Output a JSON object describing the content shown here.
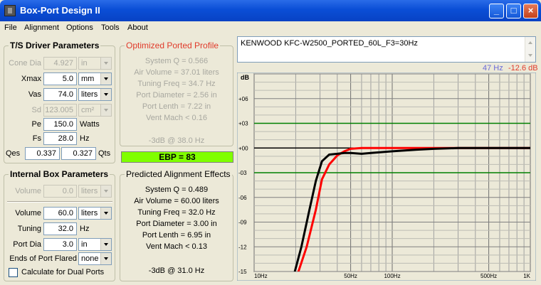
{
  "window": {
    "title": "Box-Port Design II"
  },
  "menu": [
    "File",
    "Alignment",
    "Options",
    "Tools",
    "About"
  ],
  "ts": {
    "title": "T/S Driver Parameters",
    "cone_dia": {
      "label": "Cone Dia",
      "value": "4.927",
      "unit": "in"
    },
    "xmax": {
      "label": "Xmax",
      "value": "5.0",
      "unit": "mm"
    },
    "vas": {
      "label": "Vas",
      "value": "74.0",
      "unit": "liters"
    },
    "sd": {
      "label": "Sd",
      "value": "123.005",
      "unit": "cm²"
    },
    "pe": {
      "label": "Pe",
      "value": "150.0",
      "unit": "Watts"
    },
    "fs": {
      "label": "Fs",
      "value": "28.0",
      "unit": "Hz"
    },
    "qes": {
      "label": "Qes",
      "value": "0.337"
    },
    "qts": {
      "label": "Qts",
      "value": "0.327"
    }
  },
  "box": {
    "title": "Internal Box Parameters",
    "volume_disabled": {
      "label": "Volume",
      "value": "0.0",
      "unit": "liters"
    },
    "volume": {
      "label": "Volume",
      "value": "60.0",
      "unit": "liters"
    },
    "tuning": {
      "label": "Tuning",
      "value": "32.0",
      "unit": "Hz"
    },
    "port_dia": {
      "label": "Port Dia",
      "value": "3.0",
      "unit": "in"
    },
    "flared": {
      "label": "Ends of Port Flared",
      "value": "none"
    },
    "dual": {
      "label": "Calculate for Dual Ports"
    }
  },
  "optimized": {
    "title": "Optimized Ported Profile",
    "lines": [
      "System Q = 0.566",
      "Air Volume = 37.01 liters",
      "Tuning Freq = 34.7 Hz",
      "Port Diameter = 2.56 in",
      "Port Lenth = 7.22 in",
      "Vent Mach < 0.16"
    ],
    "f3": "-3dB @ 38.0 Hz"
  },
  "ebp": "EBP = 83",
  "predicted": {
    "title": "Predicted Alignment Effects",
    "lines": [
      "System Q = 0.489",
      "Air Volume = 60.00 liters",
      "Tuning Freq = 32.0 Hz",
      "Port Diameter = 3.00 in",
      "Port Lenth = 6.95 in",
      "Vent Mach < 0.13"
    ],
    "f3": "-3dB @ 31.0 Hz"
  },
  "description": "KENWOOD KFC-W2500_PORTED_60L_F3=30Hz",
  "readout": {
    "freq": "47 Hz",
    "level": "-12.6 dB"
  },
  "colors": {
    "grid": "#a0a0a0",
    "greenline": "#008000",
    "red_curve": "#ff0000",
    "black_curve": "#000000",
    "plot_bg": "#ece9d8"
  },
  "chart_data": {
    "type": "line",
    "ylabel": "dB",
    "xscale": "log",
    "xlim": [
      10,
      1000
    ],
    "ylim": [
      -15,
      9
    ],
    "y_ticks": [
      "+06",
      "+03",
      "+00",
      "-03",
      "-06",
      "-09",
      "-12",
      "-15"
    ],
    "x_ticks": [
      "10Hz",
      "50Hz",
      "100Hz",
      "500Hz",
      "1K"
    ],
    "reference_lines": [
      3,
      -3
    ],
    "series": [
      {
        "color": "red",
        "x": [
          20,
          24,
          28,
          31,
          35,
          40,
          45,
          50,
          60,
          80,
          100,
          200,
          300,
          1000
        ],
        "y": [
          -16,
          -12,
          -7.5,
          -3.8,
          -2.0,
          -0.9,
          -0.4,
          -0.1,
          0,
          0,
          0,
          0,
          0,
          0
        ]
      },
      {
        "color": "black",
        "x": [
          19,
          22,
          25,
          28,
          31,
          35,
          40,
          45,
          50,
          60,
          70,
          100,
          150,
          200,
          300,
          1000
        ],
        "y": [
          -16,
          -12,
          -7.7,
          -4.0,
          -1.6,
          -0.8,
          -0.7,
          -0.6,
          -0.6,
          -0.7,
          -0.6,
          -0.4,
          -0.2,
          -0.1,
          0,
          0
        ]
      }
    ]
  }
}
